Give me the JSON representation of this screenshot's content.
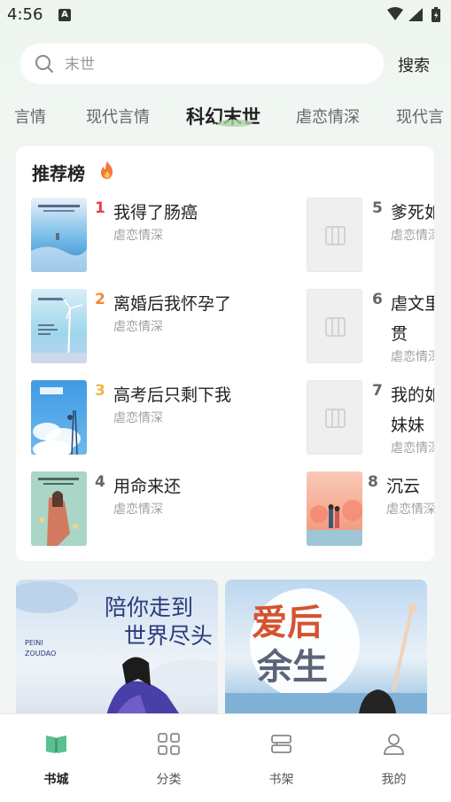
{
  "status": {
    "time": "4:56",
    "notif_letter": "A"
  },
  "search": {
    "placeholder": "末世",
    "button_label": "搜索"
  },
  "tabs": [
    {
      "label": "言情"
    },
    {
      "label": "现代言情"
    },
    {
      "label": "科幻末世"
    },
    {
      "label": "虐恋情深"
    },
    {
      "label": "现代言"
    }
  ],
  "ranking": {
    "title": "推荐榜",
    "items": [
      {
        "rank": "1",
        "title": "我得了肠癌",
        "genre": "虐恋情深"
      },
      {
        "rank": "2",
        "title": "离婚后我怀孕了",
        "genre": "虐恋情深"
      },
      {
        "rank": "3",
        "title": "高考后只剩下我",
        "genre": "虐恋情深"
      },
      {
        "rank": "4",
        "title": "用命来还",
        "genre": "虐恋情深"
      },
      {
        "rank": "5",
        "title": "爹死如",
        "genre": "虐恋情深"
      },
      {
        "rank": "6",
        "title": "虐文里",
        "title2": "贯",
        "genre": "虐恋情深"
      },
      {
        "rank": "7",
        "title": "我的如",
        "title2": "妹妹",
        "genre": "虐恋情深"
      },
      {
        "rank": "8",
        "title": "沉云",
        "genre": "虐恋情深"
      }
    ]
  },
  "banners": [
    {
      "title": "陪你走到世界尽头",
      "line1": "陪你走到",
      "line2": "世界尽头",
      "pinyin1": "PEINI",
      "pinyin2": "ZOUDAO"
    },
    {
      "title": "爱后余生",
      "line1": "爱后",
      "line2": "余生"
    }
  ],
  "bottom_nav": [
    {
      "label": "书城",
      "icon": "book-open-icon",
      "active": true
    },
    {
      "label": "分类",
      "icon": "grid-icon",
      "active": false
    },
    {
      "label": "书架",
      "icon": "bookshelf-icon",
      "active": false
    },
    {
      "label": "我的",
      "icon": "person-icon",
      "active": false
    }
  ],
  "colors": {
    "accent": "#59c08f",
    "rank1": "#e8423f",
    "rank2": "#f08a3c",
    "rank3": "#f3b347",
    "rank_other": "#666666"
  }
}
